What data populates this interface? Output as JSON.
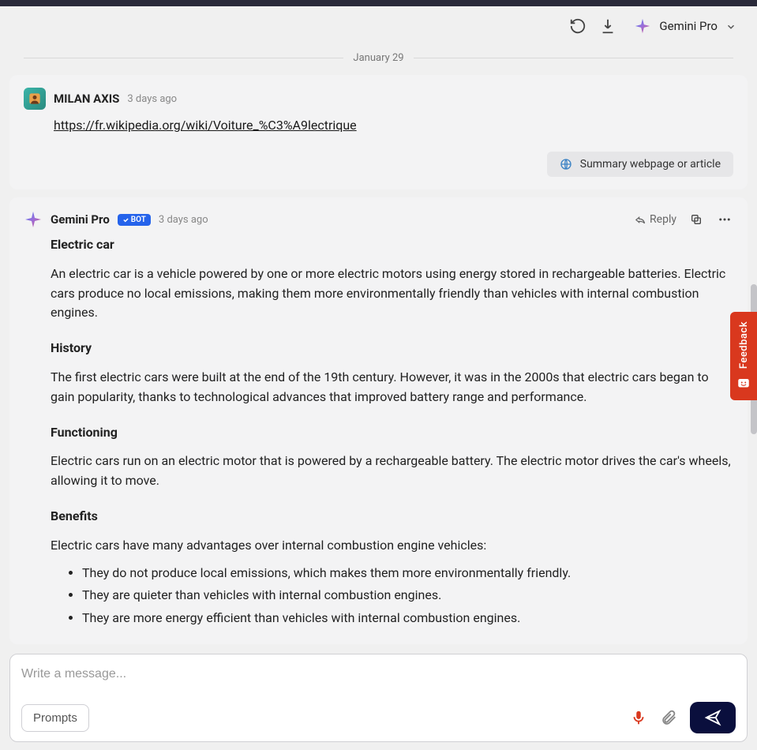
{
  "header": {
    "model_name": "Gemini Pro"
  },
  "date_divider": "January 29",
  "user_message": {
    "author": "MILAN AXIS",
    "timestamp": "3 days ago",
    "link_text": "https://fr.wikipedia.org/wiki/Voiture_%C3%A9lectrique",
    "summary_label": "Summary webpage or article"
  },
  "bot_message": {
    "author": "Gemini Pro",
    "bot_badge": "BOT",
    "timestamp": "3 days ago",
    "reply_label": "Reply",
    "content": {
      "title1": "Electric car",
      "para1": "An electric car is a vehicle powered by one or more electric motors using energy stored in rechargeable batteries. Electric cars produce no local emissions, making them more environmentally friendly than vehicles with internal combustion engines.",
      "title2": "History",
      "para2": "The first electric cars were built at the end of the 19th century. However, it was in the 2000s that electric cars began to gain popularity, thanks to technological advances that improved battery range and performance.",
      "title3": "Functioning",
      "para3": "Electric cars run on an electric motor that is powered by a rechargeable battery. The electric motor drives the car's wheels, allowing it to move.",
      "title4": "Benefits",
      "para4": "Electric cars have many advantages over internal combustion engine vehicles:",
      "bullets": [
        "They do not produce local emissions, which makes them more environmentally friendly.",
        "They are quieter than vehicles with internal combustion engines.",
        "They are more energy efficient than vehicles with internal combustion engines."
      ]
    }
  },
  "input": {
    "placeholder": "Write a message...",
    "prompts_label": "Prompts"
  },
  "feedback": {
    "label": "Feedback"
  }
}
